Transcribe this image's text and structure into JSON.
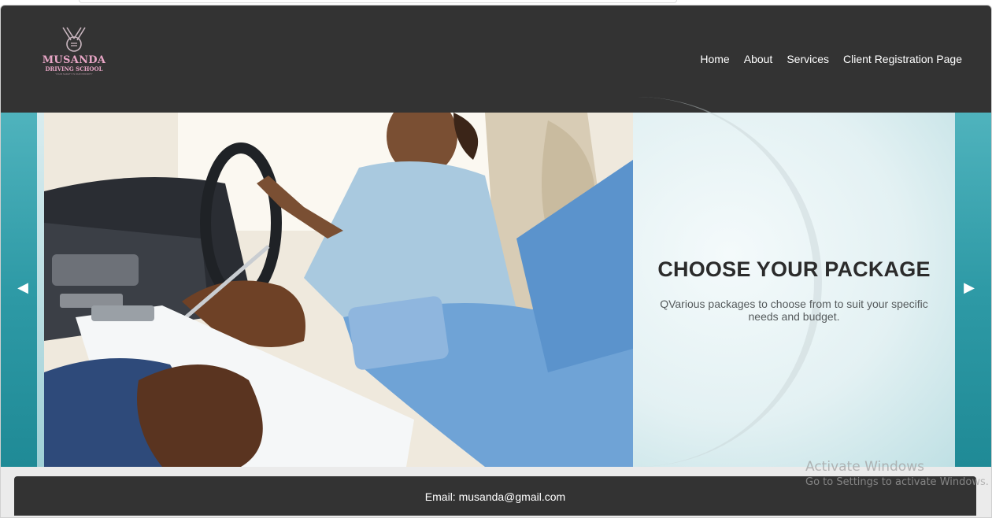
{
  "brand": {
    "name": "MUSANDA",
    "subtitle": "DRIVING SCHOOL",
    "tagline": "YOUR SAFETY IS OUR PRIORITY",
    "accent": "#e8a6c6"
  },
  "nav": {
    "items": [
      {
        "label": "Home"
      },
      {
        "label": "About"
      },
      {
        "label": "Services"
      },
      {
        "label": "Client Registration Page"
      }
    ]
  },
  "slide": {
    "title": "CHOOSE YOUR PACKAGE",
    "description": "QVarious packages to choose from to suit your specific needs and budget.",
    "prev_icon": "triangle-left-icon",
    "next_icon": "triangle-right-icon",
    "prev_glyph": "◀",
    "next_glyph": "▶"
  },
  "footer": {
    "email": "Email: musanda@gmail.com"
  },
  "watermark": {
    "line1": "Activate Windows",
    "line2": "Go to Settings to activate Windows."
  },
  "colors": {
    "header_bg": "#333333",
    "slider_bg": "#2e9aa6",
    "footer_bg": "#333333"
  }
}
